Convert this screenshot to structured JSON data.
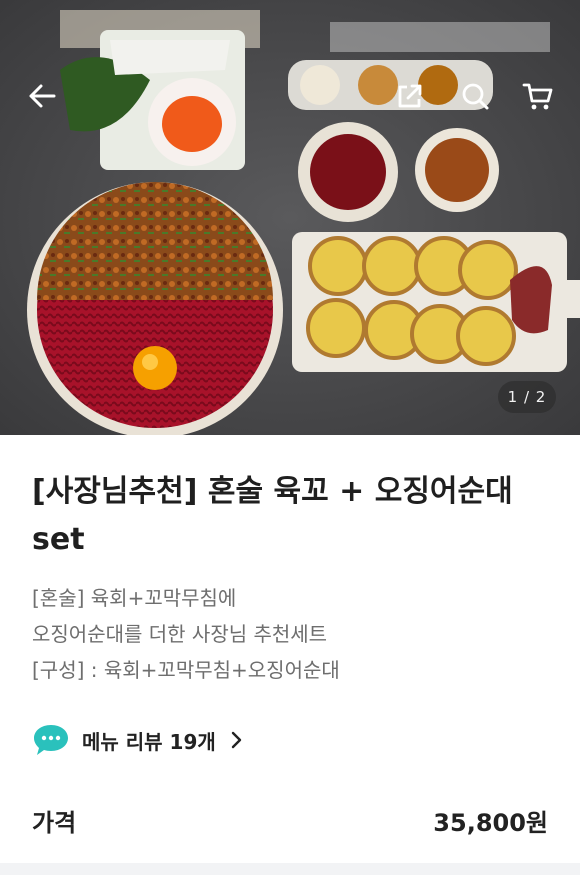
{
  "hero": {
    "pager_text": "1 / 2",
    "icons": [
      "back-arrow-icon",
      "share-icon",
      "search-icon",
      "cart-icon"
    ]
  },
  "product": {
    "title_line1": "[사장님추천] 혼술 육꼬 + 오징어순대",
    "title_line2": "set",
    "description": [
      "[혼술] 육회+꼬막무침에",
      "오징어순대를 더한 사장님 추천세트",
      "[구성] : 육회+꼬막무침+오징어순대"
    ]
  },
  "review": {
    "label": "메뉴 리뷰 19개",
    "icon_color": "#2ac1bc"
  },
  "price": {
    "label": "가격",
    "value": "35,800원"
  }
}
